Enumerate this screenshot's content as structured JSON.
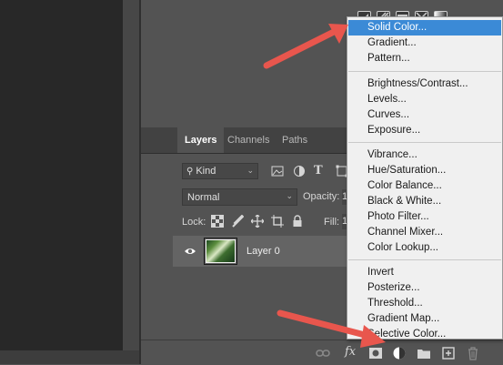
{
  "layers_panel": {
    "tabs": [
      {
        "label": "Layers",
        "active": true
      },
      {
        "label": "Channels",
        "active": false
      },
      {
        "label": "Paths",
        "active": false
      }
    ],
    "filter": {
      "kind_label": "Kind"
    },
    "blend_mode": "Normal",
    "opacity_label": "Opacity:",
    "opacity_value": "1",
    "lock_label": "Lock:",
    "fill_label": "Fill:",
    "fill_value": "1",
    "layer": {
      "name": "Layer 0"
    }
  },
  "adjustment_menu": {
    "groups": [
      [
        "Solid Color...",
        "Gradient...",
        "Pattern..."
      ],
      [
        "Brightness/Contrast...",
        "Levels...",
        "Curves...",
        "Exposure..."
      ],
      [
        "Vibrance...",
        "Hue/Saturation...",
        "Color Balance...",
        "Black & White...",
        "Photo Filter...",
        "Channel Mixer...",
        "Color Lookup..."
      ],
      [
        "Invert",
        "Posterize...",
        "Threshold...",
        "Gradient Map...",
        "Selective Color..."
      ]
    ],
    "highlighted": "Solid Color..."
  },
  "footer_icons": [
    "link-icon",
    "fx-icon",
    "add-mask-icon",
    "adjustment-layer-icon",
    "folder-icon",
    "new-layer-icon",
    "trash-icon"
  ],
  "colors": {
    "highlight": "#3b8ad6",
    "arrow": "#e8564d",
    "panel": "#535353"
  }
}
